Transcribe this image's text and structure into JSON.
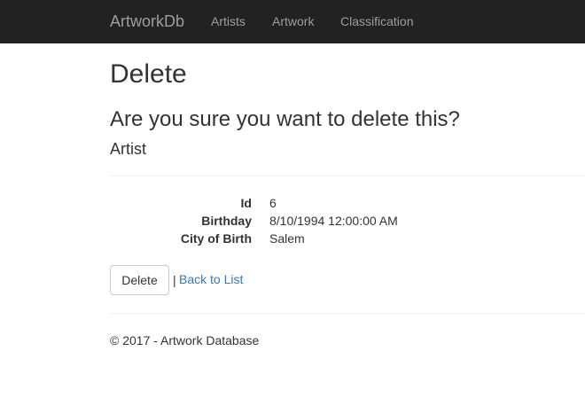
{
  "navbar": {
    "brand": "ArtworkDb",
    "links": [
      {
        "label": "Artists"
      },
      {
        "label": "Artwork"
      },
      {
        "label": "Classification"
      }
    ]
  },
  "page": {
    "title": "Delete",
    "confirm_text": "Are you sure you want to delete this?",
    "entity": "Artist"
  },
  "details": [
    {
      "label": "Id",
      "value": "6"
    },
    {
      "label": "Birthday",
      "value": "8/10/1994 12:00:00 AM"
    },
    {
      "label": "City of Birth",
      "value": "Salem"
    }
  ],
  "actions": {
    "delete_label": "Delete",
    "separator": "|",
    "back_label": "Back to List"
  },
  "footer": {
    "text": "© 2017 - Artwork Database"
  },
  "colors": {
    "navbar_bg": "#222222",
    "navbar_text": "#9d9d9d",
    "link": "#337ab7",
    "text": "#333333"
  }
}
